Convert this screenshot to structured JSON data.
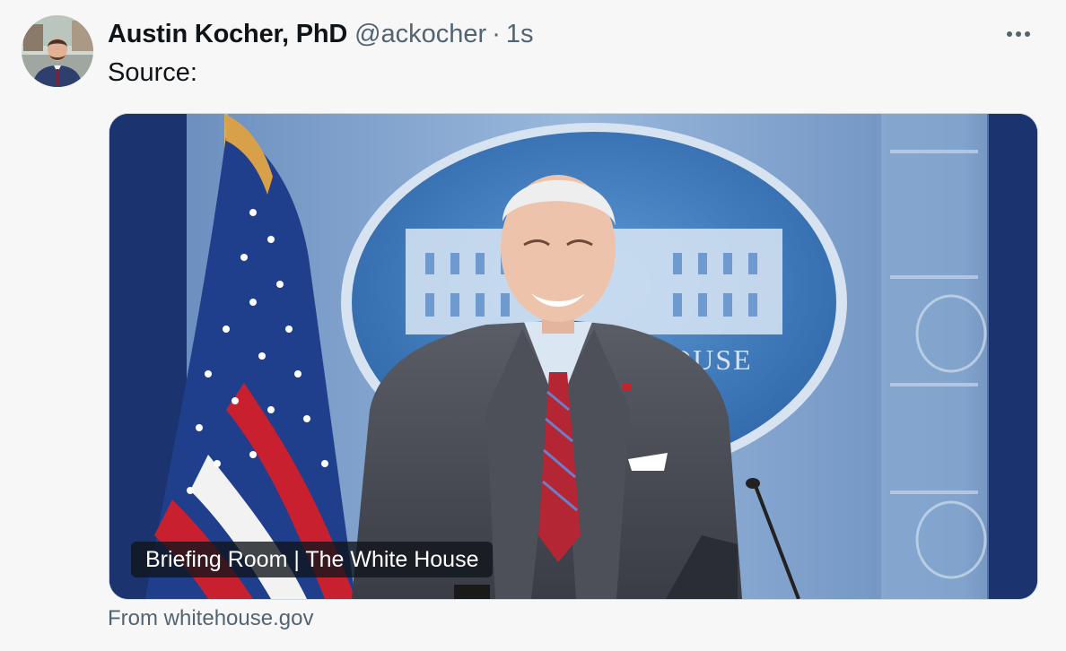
{
  "author": {
    "display_name": "Austin Kocher, PhD",
    "handle": "@ackocher",
    "separator": "·",
    "time": "1s",
    "avatar_icon": "user-avatar-photo"
  },
  "tweet": {
    "text": "Source:"
  },
  "card": {
    "caption": "Briefing Room | The White House",
    "domain": "From whitehouse.gov",
    "image": "photo-president-at-podium-white-house-briefing-room",
    "image_lettering": "WHITE HOUSE"
  },
  "menu": {
    "icon": "more-options-icon"
  },
  "colors": {
    "background": "#f7f7f7",
    "text_primary": "#0f1419",
    "text_secondary": "#536471",
    "card_border": "#cfd9de"
  }
}
